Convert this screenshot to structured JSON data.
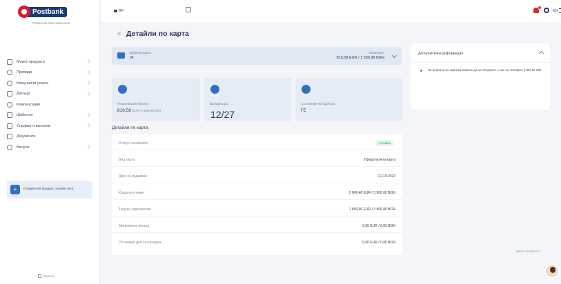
{
  "brand": {
    "name": "Postbank",
    "tagline": "Пощенска спестовна каса"
  },
  "sidebar": {
    "items": [
      {
        "label": "Моите продукти"
      },
      {
        "label": "Преводи"
      },
      {
        "label": "Комунални услуги"
      },
      {
        "label": "Данъци"
      },
      {
        "label": "Компенсации"
      },
      {
        "label": "Шаблони"
      },
      {
        "label": "Справки и выписки"
      },
      {
        "label": "Документи"
      },
      {
        "label": "Валути"
      }
    ],
    "promo": "Открий нов продукт онлайн сега",
    "footer": "Версия"
  },
  "topbar": {
    "lang": "BP",
    "lang_switch": "EN"
  },
  "header": {
    "back": "<",
    "title": "Детайли по карта"
  },
  "card_strip": {
    "type_label": "Дебитна карта",
    "number": "34",
    "amount_label": "Наличност",
    "amount": "816,58 EUR / 1 596,98 BGN"
  },
  "stats": {
    "balance_label": "Разполагаем баланс",
    "balance_value": "816,58",
    "balance_unit": "EUR / 1 596,98 BGN",
    "valid_label": "Валидна до",
    "valid_value": "12/27",
    "status_label": "Състояние на картата",
    "status_value": "ГЕ"
  },
  "details": {
    "title": "Детайли по карта",
    "rows": [
      {
        "key": "Статус на картата",
        "value": "Активна"
      },
      {
        "key": "Вид карта",
        "value": "Предплатена карта"
      },
      {
        "key": "Дата на издаване",
        "value": "21.10.2023"
      },
      {
        "key": "Кредитен лимит",
        "value": "2 006,48 EUR / 3 900,00 BGN"
      },
      {
        "key": "Текущо задължение",
        "value": "1 859,96 EUR / 3 900,00 BGN"
      },
      {
        "key": "Минимална вноска",
        "value": "0,00 EUR / 0,00 BGN"
      },
      {
        "key": "Оставащи дни за плащане",
        "value": "0,00 EUR / 0,00 BGN"
      }
    ]
  },
  "info": {
    "title": "Допълнителна информация",
    "text": "За въпроси по картата можете да се свържете с нас на телефон 0700 18 333"
  },
  "help": "Имате въпроси?"
}
